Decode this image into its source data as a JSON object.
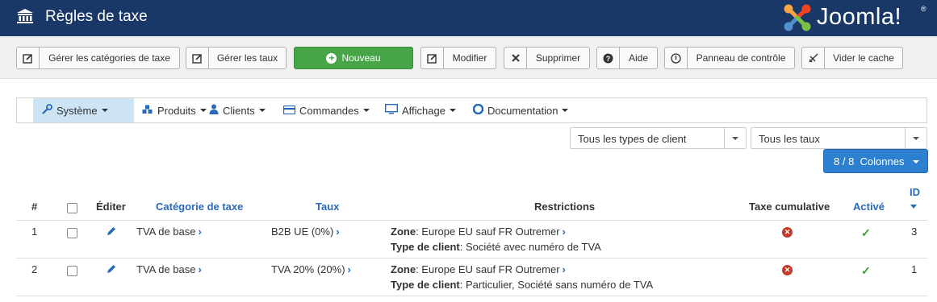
{
  "header": {
    "title": "Règles de taxe",
    "logo_text": "Joomla!",
    "logo_mark": "®"
  },
  "toolbar": {
    "manage_categories": "Gérer les catégories de taxe",
    "manage_rates": "Gérer les taux",
    "new": "Nouveau",
    "edit": "Modifier",
    "delete": "Supprimer",
    "help": "Aide",
    "control_panel": "Panneau de contrôle",
    "clear_cache": "Vider le cache"
  },
  "menu": {
    "items": [
      {
        "label": "Système",
        "icon": "wrench-icon"
      },
      {
        "label": "Produits",
        "icon": "cubes-icon"
      },
      {
        "label": "Clients",
        "icon": "user-icon"
      },
      {
        "label": "Commandes",
        "icon": "credit-card-icon"
      },
      {
        "label": "Affichage",
        "icon": "monitor-icon"
      },
      {
        "label": "Documentation",
        "icon": "lifebuoy-icon"
      }
    ]
  },
  "filters": {
    "client_type": "Tous les types de client",
    "rates": "Tous les taux",
    "columns": "8 / 8  Colonnes"
  },
  "table": {
    "headers": {
      "num": "#",
      "edit": "Éditer",
      "category": "Catégorie de taxe",
      "rate": "Taux",
      "restrictions": "Restrictions",
      "cumulative": "Taxe cumulative",
      "active": "Activé",
      "id": "ID"
    },
    "zone_label": "Zone",
    "client_type_label": "Type de client",
    "rows": [
      {
        "num": "1",
        "category": "TVA de base",
        "rate": "B2B UE (0%)",
        "zone": "Europe EU sauf FR Outremer",
        "client_type": "Société avec numéro de TVA",
        "id": "3"
      },
      {
        "num": "2",
        "category": "TVA de base",
        "rate": "TVA 20% (20%)",
        "zone": "Europe EU sauf FR Outremer",
        "client_type": "Particulier, Société sans numéro de TVA",
        "id": "1"
      }
    ]
  },
  "colors": {
    "header_bg": "#1a3867",
    "accent": "#2a69b8",
    "new_button": "#46a546",
    "columns_button": "#2d7fd0",
    "menu_active": "#cde4f5"
  }
}
